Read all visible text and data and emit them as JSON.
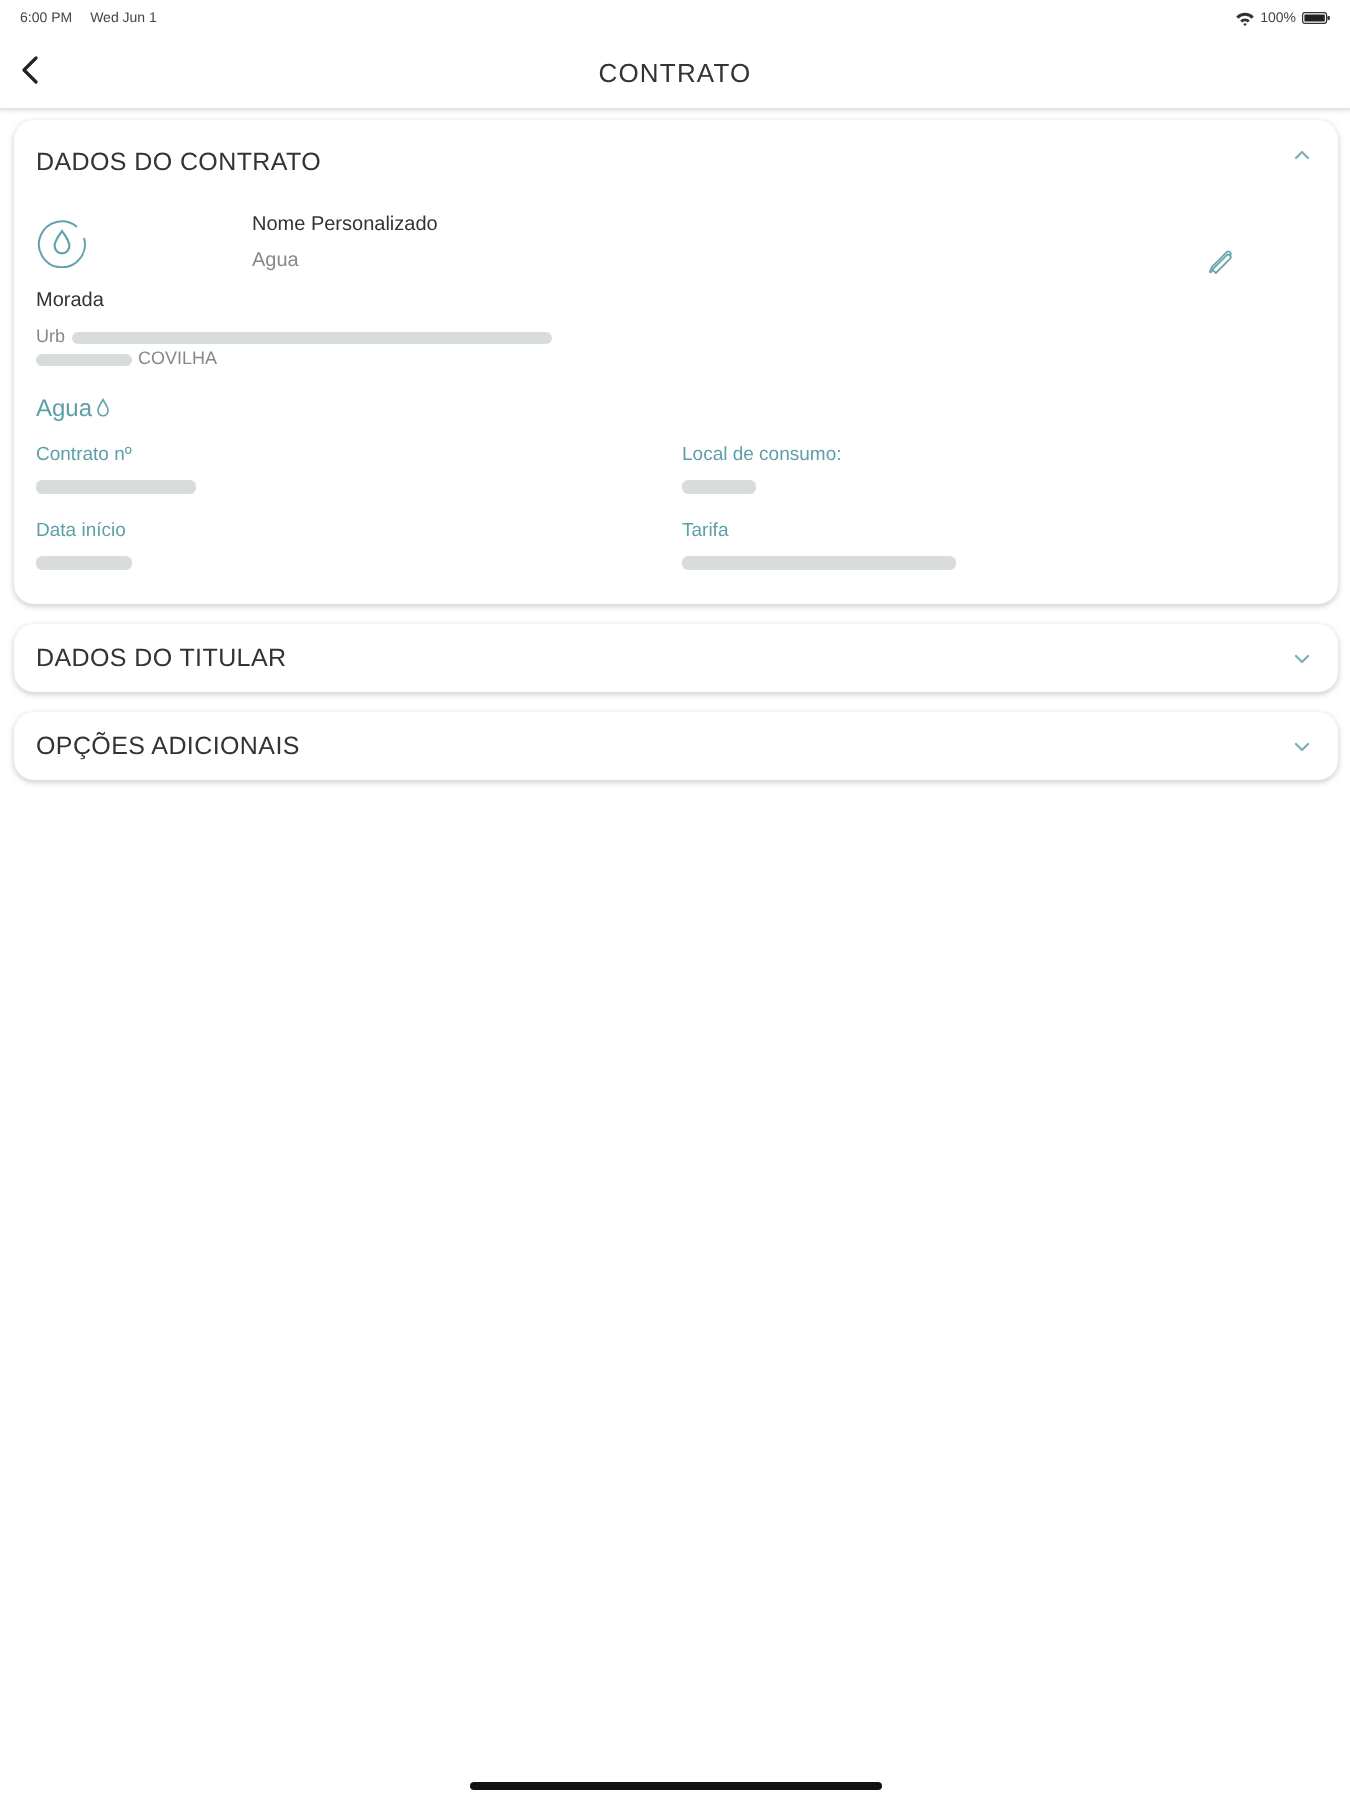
{
  "status_bar": {
    "time": "6:00 PM",
    "date": "Wed Jun 1",
    "battery": "100%"
  },
  "nav": {
    "title": "CONTRATO"
  },
  "sections": [
    {
      "title": "DADOS DO CONTRATO",
      "expanded": true,
      "details": {
        "name_label": "Nome Personalizado",
        "name_value": "Agua",
        "address_label": "Morada",
        "address_lines": [
          [
            {
              "kind": "text",
              "text": "Urb"
            },
            {
              "kind": "redacted"
            }
          ],
          [
            {
              "kind": "redacted"
            },
            {
              "kind": "text",
              "text": "COVILHA"
            }
          ]
        ],
        "service": "Agua",
        "fields": [
          {
            "label": "Contrato nº",
            "value": {
              "kind": "redacted"
            }
          },
          {
            "label": "Local de consumo:",
            "value": {
              "kind": "redacted"
            }
          },
          {
            "label": "Data início",
            "value": {
              "kind": "redacted"
            }
          },
          {
            "label": "Tarifa",
            "value": {
              "kind": "redacted"
            }
          }
        ]
      }
    },
    {
      "title": "DADOS DO TITULAR",
      "expanded": false
    },
    {
      "title": "OPÇÕES ADICIONAIS",
      "expanded": false
    }
  ]
}
